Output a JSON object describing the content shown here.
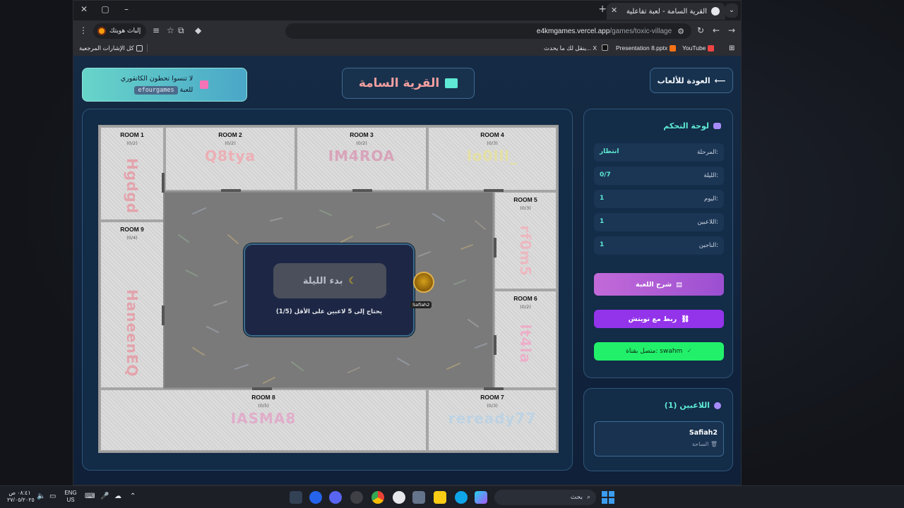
{
  "browser": {
    "tab_title": "القرية السامة - لعبة تفاعلية",
    "url_host": "e4kmgames.vercel.app",
    "url_path": "/games/toxic-village",
    "profile_label": "إلباث هويتك",
    "bookmarks": [
      {
        "label": "YouTube",
        "color": "#ef4444"
      },
      {
        "label": "Presentation 8.pptx",
        "color": "#f97316"
      },
      {
        "label": "X",
        "color": "#e5e7eb"
      },
      {
        "label": "ينقل لك ما يحدث... X",
        "color": "#e5e7eb"
      }
    ],
    "bookmarks_folder": "كل الإشارات المرجعية"
  },
  "header": {
    "back_label": "العودة للألعاب",
    "title": "القرية السامة",
    "notice_line1": "لا تنسوا تحطون الكاتقوري",
    "notice_chip": "efourgames",
    "notice_line2": "للعبة"
  },
  "rooms": [
    {
      "name": "ROOM 1",
      "count": "(0/2)",
      "owner": "Hgdgd",
      "color": "#e69aa5"
    },
    {
      "name": "ROOM 2",
      "count": "(0/2)",
      "owner": "Q8tya",
      "color": "#f0a8b0"
    },
    {
      "name": "ROOM 3",
      "count": "(0/2)",
      "owner": "IM4ROA",
      "color": "#d99bb5"
    },
    {
      "name": "ROOM 4",
      "count": "(0/3)",
      "owner": "lo0lll_",
      "color": "#e7e29a"
    },
    {
      "name": "ROOM 5",
      "count": "(0/3)",
      "owner": "rf0m5",
      "color": "#f0b3bd"
    },
    {
      "name": "ROOM 6",
      "count": "(0/2)",
      "owner": "lt4la",
      "color": "#f0a8c6"
    },
    {
      "name": "ROOM 7",
      "count": "(0/3)",
      "owner": "reready77",
      "color": "#b9d3e6"
    },
    {
      "name": "ROOM 8",
      "count": "(0/5)",
      "owner": "IASMA8",
      "color": "#e2a6c8"
    },
    {
      "name": "ROOM 9",
      "count": "(0/4)",
      "owner": "HaneenEQ",
      "color": "#e69aa5"
    }
  ],
  "modal": {
    "start_label": "بدء الليلة",
    "need_text": "يحتاج إلى 5 لاعبين على الأقل (1/5)"
  },
  "avatar_name": "Safiah2",
  "control": {
    "title": "لوحة التحكم",
    "stats": [
      {
        "key": "المرحلة:",
        "value": "انتظار"
      },
      {
        "key": "الليلة:",
        "value": "0/7"
      },
      {
        "key": "اليوم:",
        "value": "1"
      },
      {
        "key": "اللاعبين:",
        "value": "1"
      },
      {
        "key": "الناجين:",
        "value": "1"
      }
    ],
    "explain_label": "شرح اللعبة",
    "twitch_label": "ربط مع تويتش",
    "connected_label": "متصل بقناة: swahm"
  },
  "players": {
    "title": "اللاعبين (1)",
    "list": [
      {
        "name": "Safiah2",
        "location": "الساحة"
      }
    ]
  },
  "taskbar": {
    "search_placeholder": "بحث",
    "lang_top": "ENG",
    "lang_bottom": "US",
    "time": "٠٨:٤١ ص",
    "date": "٢٧/٠٥/٢٠٢٥"
  }
}
